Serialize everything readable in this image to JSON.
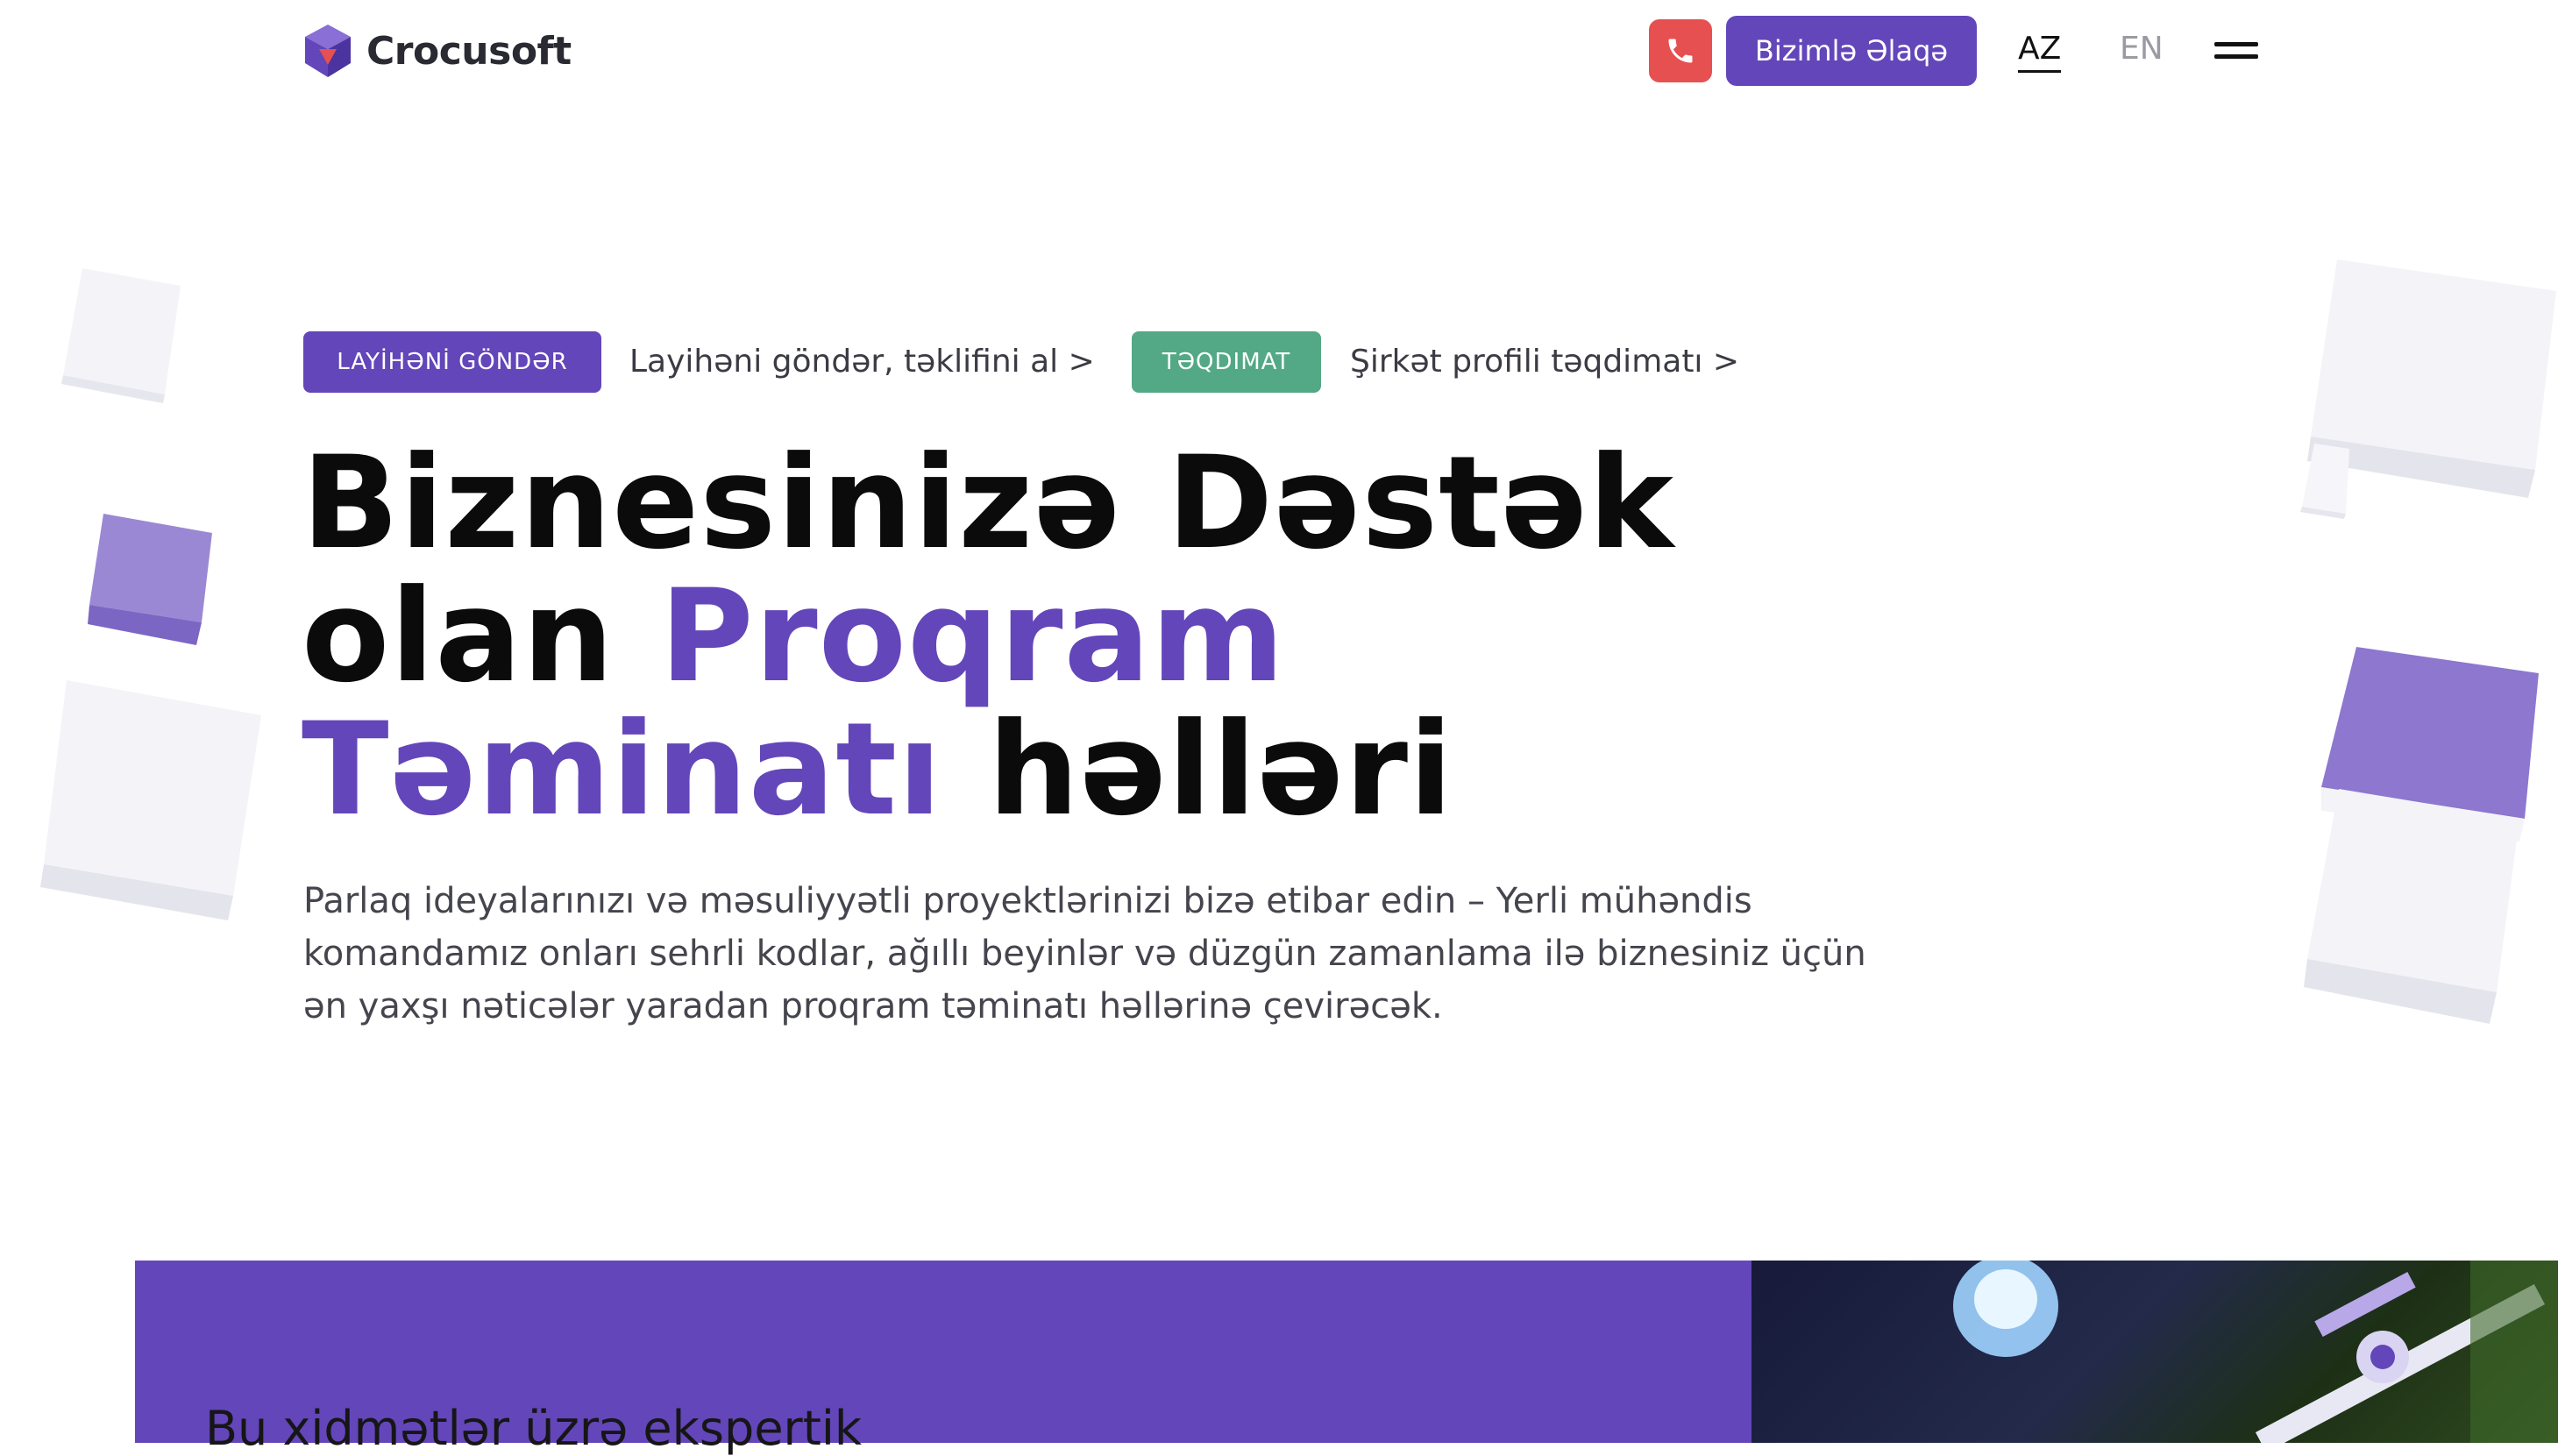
{
  "header": {
    "brand": "Crocusoft",
    "contact_label": "Bizimlə Əlaqə",
    "lang_az": "AZ",
    "lang_en": "EN"
  },
  "hero": {
    "tag_send": "LAYİHƏNİ GÖNDƏR",
    "link_send": "Layihəni göndər, təklifini al >",
    "tag_presentation": "TƏQDIMAT",
    "link_presentation": "Şirkət profili təqdimatı >",
    "headline_part1": "Biznesinizə Dəstək",
    "headline_part2": "olan ",
    "headline_accent1": "Proqram",
    "headline_accent2": "Təminatı",
    "headline_part3": " həlləri",
    "lead": "Parlaq ideyalarınızı və məsuliyyətli proyektlərinizi bizə etibar edin – Yerli mühəndis komandamız onları sehrli kodlar, ağıllı beyinlər və düzgün zamanlama ilə biznesiniz üçün ən yaxşı nəticələr yaradan proqram təminatı həllərinə çevirəcək."
  },
  "services": {
    "title": "Bu xidmətlər üzrə ekspertik"
  },
  "colors": {
    "accent": "#6346b9",
    "phone": "#e65050",
    "presentation": "#53a985"
  },
  "icons": [
    "crocusoft-logo-icon",
    "phone-icon",
    "menu-icon"
  ]
}
